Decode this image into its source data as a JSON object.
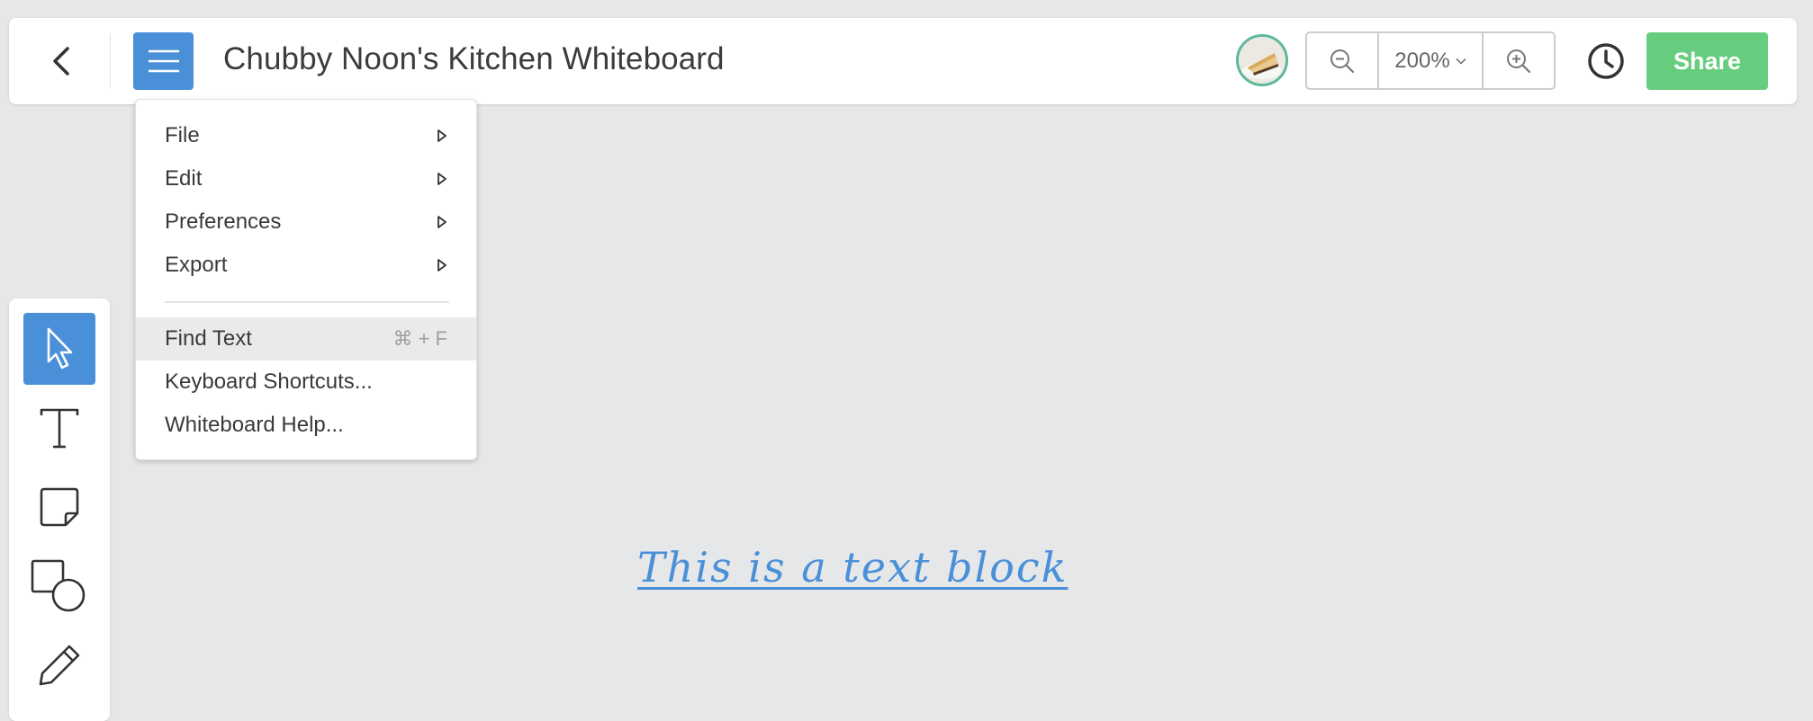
{
  "header": {
    "title": "Chubby Noon's Kitchen Whiteboard",
    "zoom_level": "200%",
    "share_label": "Share"
  },
  "menu": {
    "items": [
      {
        "label": "File",
        "has_submenu": true
      },
      {
        "label": "Edit",
        "has_submenu": true
      },
      {
        "label": "Preferences",
        "has_submenu": true
      },
      {
        "label": "Export",
        "has_submenu": true
      }
    ],
    "find_text": {
      "label": "Find Text",
      "shortcut": "⌘ + F"
    },
    "keyboard_shortcuts": "Keyboard Shortcuts...",
    "whiteboard_help": "Whiteboard Help..."
  },
  "toolbar": {
    "tools": [
      "pointer-icon",
      "text-icon",
      "sticky-note-icon",
      "shapes-icon",
      "pencil-icon"
    ],
    "active_tool": "pointer-icon"
  },
  "canvas": {
    "text_block": "This is a text block"
  },
  "colors": {
    "accent_blue": "#4a90d9",
    "share_green": "#67cd7e",
    "canvas_bg": "#e6e7e9"
  }
}
